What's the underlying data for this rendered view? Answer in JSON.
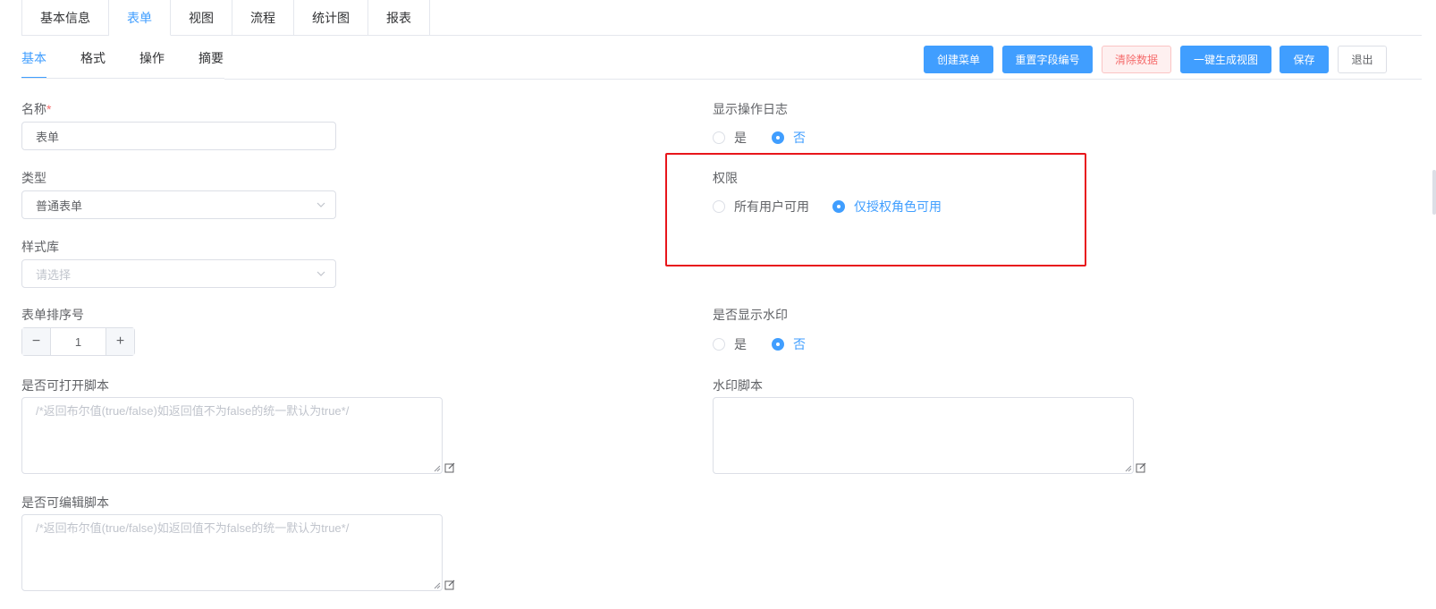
{
  "top_tabs": [
    {
      "label": "基本信息"
    },
    {
      "label": "表单",
      "active": true
    },
    {
      "label": "视图"
    },
    {
      "label": "流程"
    },
    {
      "label": "统计图"
    },
    {
      "label": "报表"
    }
  ],
  "sub_tabs": [
    {
      "label": "基本",
      "active": true
    },
    {
      "label": "格式"
    },
    {
      "label": "操作"
    },
    {
      "label": "摘要"
    }
  ],
  "toolbar": {
    "create_menu": "创建菜单",
    "reset_field_no": "重置字段编号",
    "clear_data": "清除数据",
    "generate_view": "一键生成视图",
    "save": "保存",
    "exit": "退出"
  },
  "form": {
    "name": {
      "label": "名称",
      "required_mark": "*",
      "value": "表单"
    },
    "type": {
      "label": "类型",
      "value": "普通表单"
    },
    "style_lib": {
      "label": "样式库",
      "placeholder": "请选择"
    },
    "sort_no": {
      "label": "表单排序号",
      "value": "1",
      "minus": "−",
      "plus": "+"
    },
    "open_script": {
      "label": "是否可打开脚本",
      "placeholder": "/*返回布尔值(true/false)如返回值不为false的统一默认为true*/"
    },
    "edit_script": {
      "label": "是否可编辑脚本",
      "placeholder": "/*返回布尔值(true/false)如返回值不为false的统一默认为true*/"
    },
    "show_log": {
      "label": "显示操作日志",
      "options": [
        "是",
        "否"
      ],
      "selected": "否"
    },
    "permission": {
      "label": "权限",
      "options": [
        "所有用户可用",
        "仅授权角色可用"
      ],
      "selected": "仅授权角色可用"
    },
    "show_watermark": {
      "label": "是否显示水印",
      "options": [
        "是",
        "否"
      ],
      "selected": "否"
    },
    "watermark_script": {
      "label": "水印脚本",
      "value": ""
    }
  },
  "colors": {
    "primary": "#409eff",
    "danger": "#f56c6c",
    "highlight_border": "#e8151b"
  }
}
